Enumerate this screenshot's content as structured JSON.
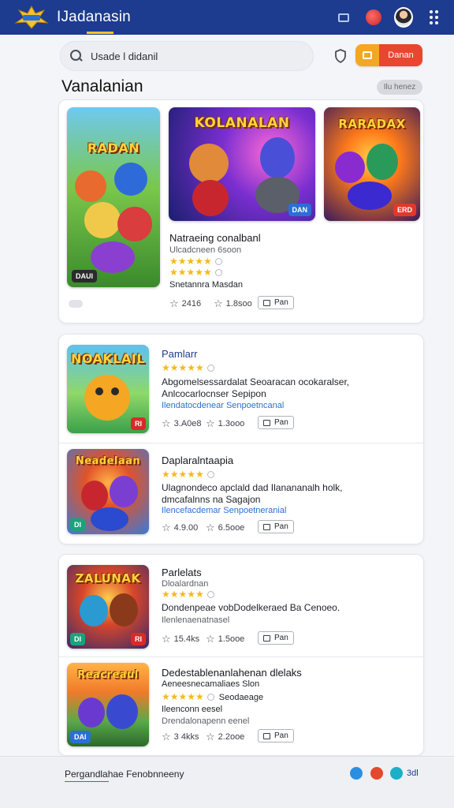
{
  "header": {
    "logo_icon": "game-logo-icon",
    "title": "IJadanasin",
    "icons": [
      "cast-icon",
      "notification-icon",
      "avatar",
      "more-vert-icon"
    ],
    "background": "#1d3b8f"
  },
  "search": {
    "value": "Usade l didanil",
    "icon": "search-icon"
  },
  "toolbar": {
    "shield_icon": "shield-icon",
    "action_icon": "bookmark-icon",
    "action_label": "Danan"
  },
  "section": {
    "title": "Vanalanian",
    "pill": "Ilu henez"
  },
  "featured": {
    "games": [
      {
        "title": "RADAN",
        "badge": "DAUI"
      },
      {
        "title": "KOLANALAN",
        "badge": "DAN"
      },
      {
        "title": "RARADAX",
        "badge": "ERD"
      }
    ],
    "title": "Natraeing conalbanl",
    "subtitle": "Ulcadcneen 6soon",
    "rating_1": "★★★★★",
    "rating_2": "★★★★★",
    "author": "Snetannra Masdan",
    "stats": [
      "2416",
      "1.8soo"
    ],
    "button": "Pan",
    "extra_icon": "controller-icon"
  },
  "list_1": [
    {
      "art_title": "NOAKLAIL",
      "art_badge": "RI",
      "title": "Pamlarr",
      "stars": "★★★★★",
      "desc_1": "Abgomelsessardalat Seoaracan ocokaralser,",
      "desc_2": "Anlcocarlocnser Sepipon",
      "link": "Ilendatocdenear Senpoetncanal",
      "stats": [
        "3.A0e8",
        "1.3ooo"
      ],
      "button": "Pan"
    },
    {
      "art_title": "Neadelaan",
      "art_badge": "DI",
      "title": "Daplaralntaapia",
      "stars": "★★★★★",
      "desc_1": "Ulagnondeco apclald dad Ilanananalh holk,",
      "desc_2": "dmcafalnns na Sagajon",
      "link": "Ilencefacdemar Senpoetneranial",
      "stats": [
        "4.9.00",
        "6.5ooe"
      ],
      "button": "Pan"
    }
  ],
  "list_2": [
    {
      "art_title": "ZALUNAK",
      "art_badge_left": "DI",
      "art_badge_right": "RI",
      "title": "Parlelats",
      "subtitle": "Dloalardnan",
      "stars": "★★★★★",
      "desc_1": "Dondenpeae vobDodelkeraed Ba Cenoeo.",
      "desc_2": "Ilenlenaenatnasel",
      "stats": [
        "15.4ks",
        "1.5ooe"
      ],
      "button": "Pan"
    },
    {
      "art_title": "Reacreaul",
      "art_badge": "DAI",
      "title": "Dedestablenanlahenan dlelaks",
      "subtitle": "Aeneesnecamaliaes Slon",
      "stars": "★★★★★",
      "stars_extra": "Seodaeage",
      "desc_1": "Ileenconn eesel",
      "desc_2": "Drendalonapenn eenel",
      "stats": [
        "3 4kks",
        "2.2ooe"
      ],
      "button": "Pan"
    }
  ],
  "footer": {
    "text": "Pergandlahae Fenobnneeny",
    "tag": "3dl",
    "social": [
      "facebook-icon",
      "reddit-icon",
      "twitter-icon"
    ],
    "colors": [
      "#2a8fe0",
      "#e34a2b",
      "#1ab0c9"
    ]
  }
}
